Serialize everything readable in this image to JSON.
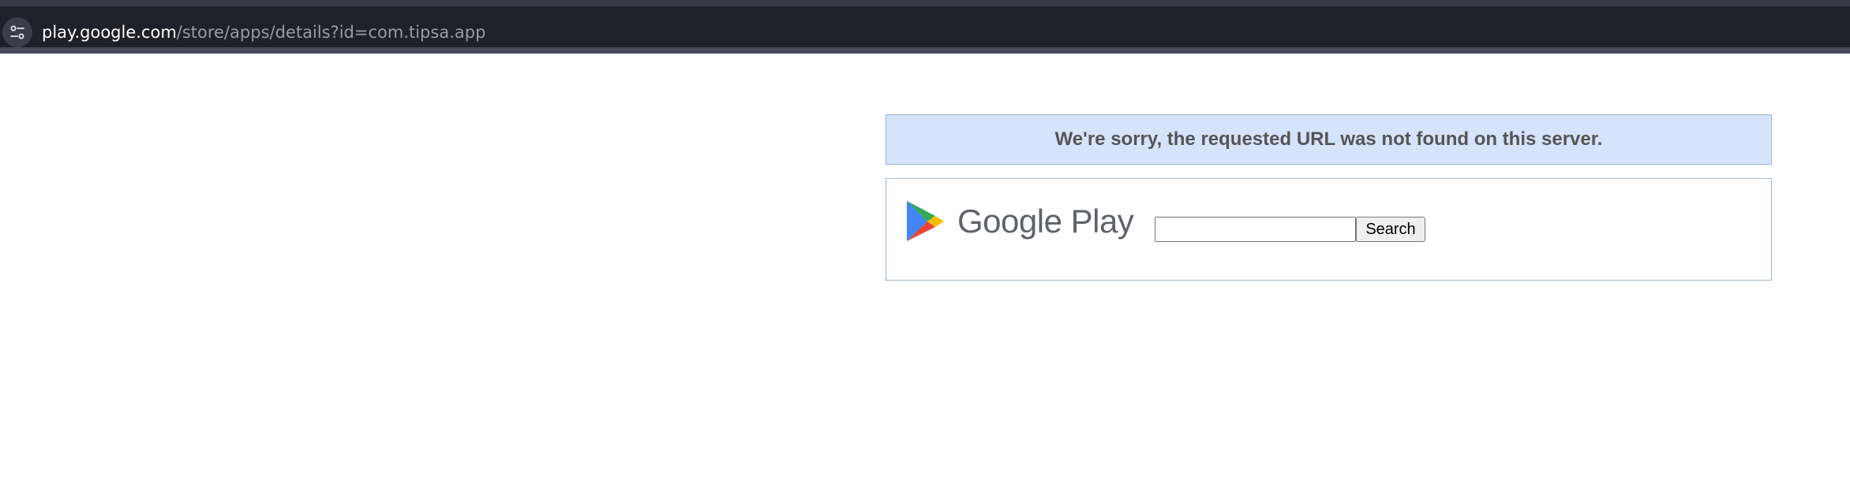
{
  "browser": {
    "url_host": "play.google.com",
    "url_path": "/store/apps/details?id=com.tipsa.app",
    "site_info_icon": "tune-icon"
  },
  "error": {
    "message": "We're sorry, the requested URL was not found on this server."
  },
  "play": {
    "logo_text": "Google Play",
    "logo_icon": "google-play-icon",
    "search_value": "",
    "search_button_label": "Search"
  },
  "colors": {
    "chrome_bg": "#25262f",
    "banner_bg": "#d5e3fb",
    "border": "#9eb4d3",
    "error_text": "#555555",
    "wordmark": "#5f6368"
  }
}
